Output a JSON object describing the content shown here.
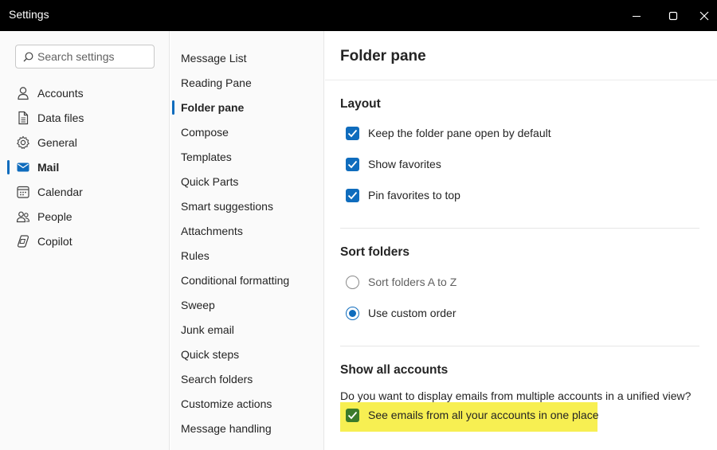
{
  "window": {
    "title": "Settings"
  },
  "search": {
    "placeholder": "Search settings"
  },
  "nav": {
    "items": [
      {
        "label": "Accounts",
        "icon": "person-icon"
      },
      {
        "label": "Data files",
        "icon": "document-icon"
      },
      {
        "label": "General",
        "icon": "gear-icon"
      },
      {
        "label": "Mail",
        "icon": "mail-icon",
        "active": true
      },
      {
        "label": "Calendar",
        "icon": "calendar-icon"
      },
      {
        "label": "People",
        "icon": "people-icon"
      },
      {
        "label": "Copilot",
        "icon": "copilot-icon"
      }
    ]
  },
  "subnav": {
    "items": [
      {
        "label": "Message List"
      },
      {
        "label": "Reading Pane"
      },
      {
        "label": "Folder pane",
        "active": true
      },
      {
        "label": "Compose"
      },
      {
        "label": "Templates"
      },
      {
        "label": "Quick Parts"
      },
      {
        "label": "Smart suggestions"
      },
      {
        "label": "Attachments"
      },
      {
        "label": "Rules"
      },
      {
        "label": "Conditional formatting"
      },
      {
        "label": "Sweep"
      },
      {
        "label": "Junk email"
      },
      {
        "label": "Quick steps"
      },
      {
        "label": "Search folders"
      },
      {
        "label": "Customize actions"
      },
      {
        "label": "Message handling"
      }
    ]
  },
  "content": {
    "title": "Folder pane",
    "layout": {
      "title": "Layout",
      "options": [
        {
          "label": "Keep the folder pane open by default",
          "checked": true
        },
        {
          "label": "Show favorites",
          "checked": true
        },
        {
          "label": "Pin favorites to top",
          "checked": true
        }
      ]
    },
    "sort": {
      "title": "Sort folders",
      "options": [
        {
          "label": "Sort folders A to Z",
          "selected": false
        },
        {
          "label": "Use custom order",
          "selected": true
        }
      ]
    },
    "accounts": {
      "title": "Show all accounts",
      "question": "Do you want to display emails from multiple accounts in a unified view?",
      "option": {
        "label": "See emails from all your accounts in one place",
        "checked": true
      }
    }
  },
  "colors": {
    "accent": "#0f6cbd",
    "highlight": "#f7ef52",
    "highlight_check": "#3b7a2a",
    "titlebar": "#000000"
  }
}
